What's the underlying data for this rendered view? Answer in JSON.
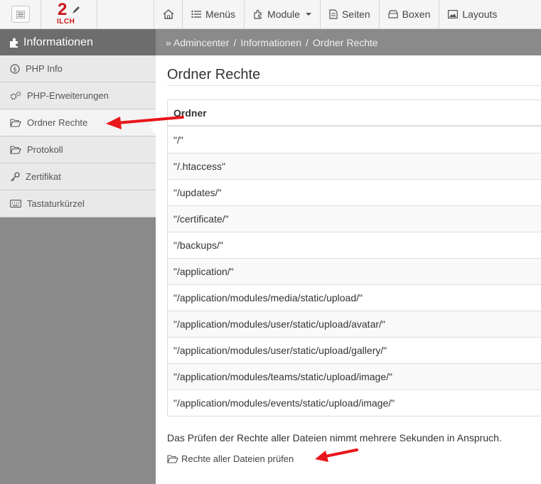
{
  "topnav": {
    "logo_number": "2",
    "logo_text": "ILCH",
    "items": [
      {
        "label": "",
        "icon": "home-icon"
      },
      {
        "label": "Menüs",
        "icon": "menu-list-icon"
      },
      {
        "label": "Module",
        "icon": "puzzle-icon",
        "dropdown": true
      },
      {
        "label": "Seiten",
        "icon": "page-icon"
      },
      {
        "label": "Boxen",
        "icon": "box-icon"
      },
      {
        "label": "Layouts",
        "icon": "image-icon"
      }
    ]
  },
  "sidebar": {
    "title": "Informationen",
    "items": [
      {
        "label": "PHP Info",
        "icon": "dollar-circle-icon"
      },
      {
        "label": "PHP-Erweiterungen",
        "icon": "cogs-icon"
      },
      {
        "label": "Ordner Rechte",
        "icon": "folder-open-icon",
        "active": true
      },
      {
        "label": "Protokoll",
        "icon": "folder-open-icon"
      },
      {
        "label": "Zertifikat",
        "icon": "key-icon"
      },
      {
        "label": "Tastaturkürzel",
        "icon": "keyboard-icon"
      }
    ]
  },
  "breadcrumb": {
    "items": [
      "» Admincenter",
      "Informationen",
      "Ordner Rechte"
    ],
    "separator": "/"
  },
  "main": {
    "title": "Ordner Rechte",
    "table": {
      "header": "Ordner",
      "rows": [
        "\"/\"",
        "\"/.htaccess\"",
        "\"/updates/\"",
        "\"/certificate/\"",
        "\"/backups/\"",
        "\"/application/\"",
        "\"/application/modules/media/static/upload/\"",
        "\"/application/modules/user/static/upload/avatar/\"",
        "\"/application/modules/user/static/upload/gallery/\"",
        "\"/application/modules/teams/static/upload/image/\"",
        "\"/application/modules/events/static/upload/image/\""
      ]
    },
    "note": "Das Prüfen der Rechte aller Dateien nimmt mehrere Sekunden in Anspruch.",
    "check_link": "Rechte aller Dateien prüfen"
  },
  "colors": {
    "brand": "#c8151b",
    "annotation_arrow": "#e8161b",
    "sidebar_bg": "#8a8a8a",
    "sidebar_title_bg": "#6d6d6d"
  }
}
